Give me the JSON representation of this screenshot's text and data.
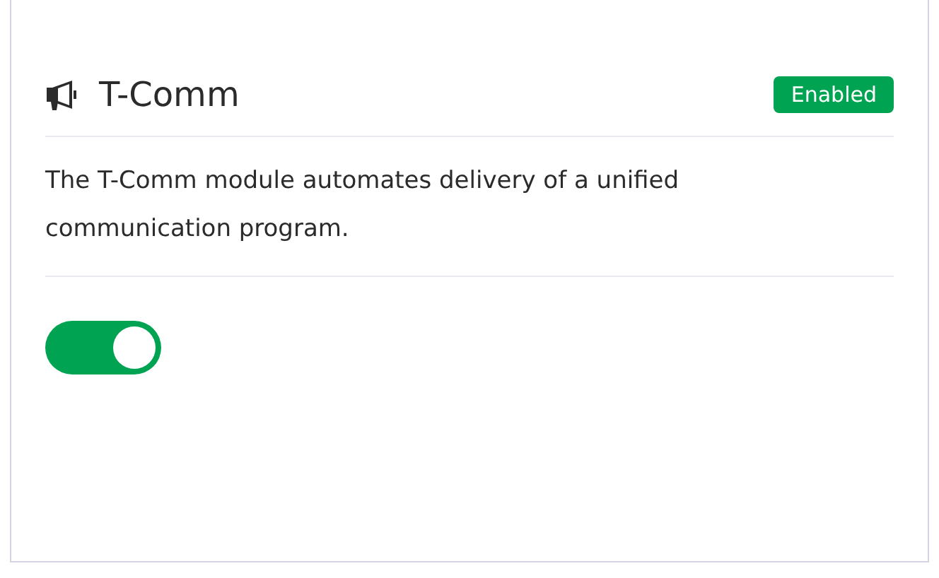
{
  "module": {
    "title": "T-Comm",
    "status": {
      "label": "Enabled",
      "enabled": true
    },
    "description": "The T-Comm module automates delivery of a unified communication program.",
    "toggle": {
      "on": true
    }
  }
}
